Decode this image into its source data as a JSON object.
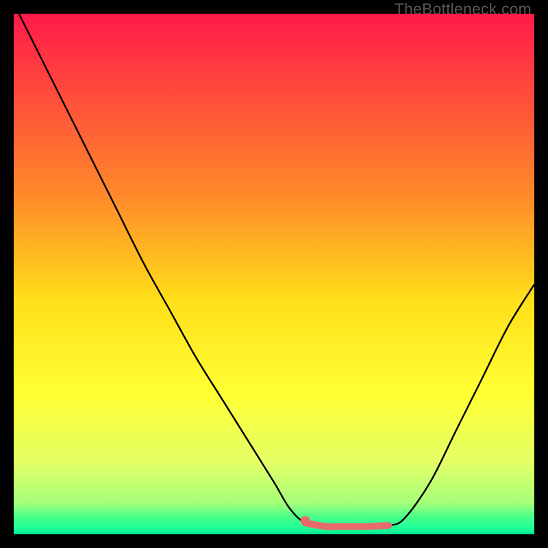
{
  "watermark": "TheBottleneck.com",
  "chart_data": {
    "type": "line",
    "title": "",
    "xlabel": "",
    "ylabel": "",
    "xlim": [
      0,
      100
    ],
    "ylim": [
      0,
      100
    ],
    "series": [
      {
        "name": "curve",
        "color": "#000000",
        "points": [
          {
            "x": 1,
            "y": 100
          },
          {
            "x": 5,
            "y": 92
          },
          {
            "x": 10,
            "y": 82
          },
          {
            "x": 15,
            "y": 72
          },
          {
            "x": 20,
            "y": 62
          },
          {
            "x": 25,
            "y": 52
          },
          {
            "x": 30,
            "y": 43
          },
          {
            "x": 35,
            "y": 34
          },
          {
            "x": 40,
            "y": 26
          },
          {
            "x": 45,
            "y": 18
          },
          {
            "x": 50,
            "y": 10
          },
          {
            "x": 53,
            "y": 5
          },
          {
            "x": 56,
            "y": 2.2
          },
          {
            "x": 60,
            "y": 1.5
          },
          {
            "x": 64,
            "y": 1.5
          },
          {
            "x": 68,
            "y": 1.5
          },
          {
            "x": 72,
            "y": 1.7
          },
          {
            "x": 75,
            "y": 3
          },
          {
            "x": 80,
            "y": 10
          },
          {
            "x": 85,
            "y": 20
          },
          {
            "x": 90,
            "y": 30
          },
          {
            "x": 95,
            "y": 40
          },
          {
            "x": 100,
            "y": 48
          }
        ]
      },
      {
        "name": "highlight",
        "color": "#e86a6a",
        "points": [
          {
            "x": 56,
            "y": 2.2
          },
          {
            "x": 60,
            "y": 1.5
          },
          {
            "x": 64,
            "y": 1.5
          },
          {
            "x": 68,
            "y": 1.5
          },
          {
            "x": 72,
            "y": 1.7
          }
        ]
      }
    ],
    "marker": {
      "x": 56,
      "y": 2.6,
      "color": "#e86a6a"
    },
    "gradient_stops": [
      {
        "offset": 0,
        "color": "#ff1a4a"
      },
      {
        "offset": 0.35,
        "color": "#ff8a2a"
      },
      {
        "offset": 0.55,
        "color": "#ffdf1a"
      },
      {
        "offset": 0.73,
        "color": "#ffff33"
      },
      {
        "offset": 0.86,
        "color": "#e4ff66"
      },
      {
        "offset": 0.94,
        "color": "#a6ff7a"
      },
      {
        "offset": 0.965,
        "color": "#4dff88"
      },
      {
        "offset": 0.99,
        "color": "#1aff9a"
      },
      {
        "offset": 1.0,
        "color": "#00e692"
      }
    ]
  }
}
